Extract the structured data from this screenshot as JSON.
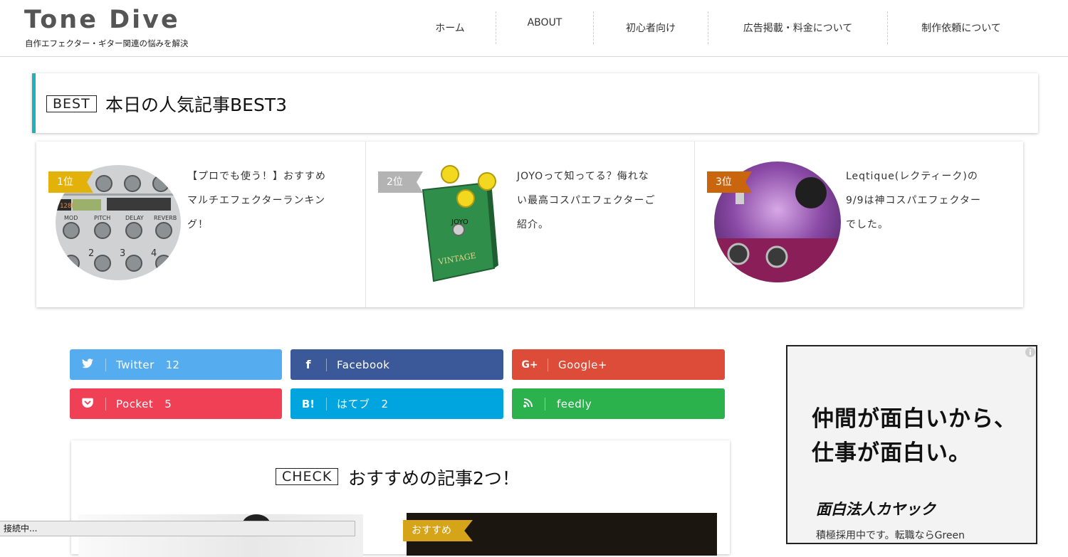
{
  "site": {
    "title": "Tone Dive",
    "tagline": "自作エフェクター・ギター関連の悩みを解決"
  },
  "nav": {
    "items": [
      {
        "label": "ホーム"
      },
      {
        "label": "ABOUT"
      },
      {
        "label": "初心者向け"
      },
      {
        "label": "広告掲載・料金について"
      },
      {
        "label": "制作依頼について"
      }
    ]
  },
  "best": {
    "tag": "BEST",
    "title": "本日の人気記事BEST3",
    "accent_color": "#1fb3b8",
    "items": [
      {
        "rank": "1位",
        "title": "【プロでも使う！】おすすめマルチエフェクターランキング！",
        "rank_color": "#e2b20a",
        "image": "multi-effects-pedal-photo"
      },
      {
        "rank": "2位",
        "title": "JOYOって知ってる？侮れない最高コスパエフェクターご紹介。",
        "rank_color": "#b3b3b3",
        "image": "green-overdrive-pedal-photo"
      },
      {
        "rank": "3位",
        "title": "Leqtique(レクティーク)の9/9は神コスパエフェクターでした。",
        "rank_color": "#c9650d",
        "image": "purple-pedal-photo"
      }
    ]
  },
  "share": {
    "buttons": [
      {
        "icon": "twitter-icon",
        "label": "Twitter",
        "count": "12",
        "color": "#55acee"
      },
      {
        "icon": "facebook-icon",
        "label": "Facebook",
        "count": "",
        "color": "#3b5998"
      },
      {
        "icon": "google-plus-icon",
        "label": "Google+",
        "count": "",
        "color": "#dd4b39"
      },
      {
        "icon": "pocket-icon",
        "label": "Pocket",
        "count": "5",
        "color": "#ef4056"
      },
      {
        "icon": "hatena-bookmark-icon",
        "label": "はてブ",
        "count": "2",
        "color": "#00a4de"
      },
      {
        "icon": "feedly-icon",
        "label": "feedly",
        "count": "",
        "color": "#2bb24c"
      }
    ]
  },
  "check": {
    "tag": "CHECK",
    "title": "おすすめの記事2つ！",
    "badge": "おすすめ"
  },
  "ad": {
    "line1": "仲間が面白いから、",
    "line2": "仕事が面白い。",
    "brand": "面白法人カヤック",
    "sub": "積極採用中です。転職ならGreen"
  },
  "status": {
    "text": "接続中..."
  }
}
